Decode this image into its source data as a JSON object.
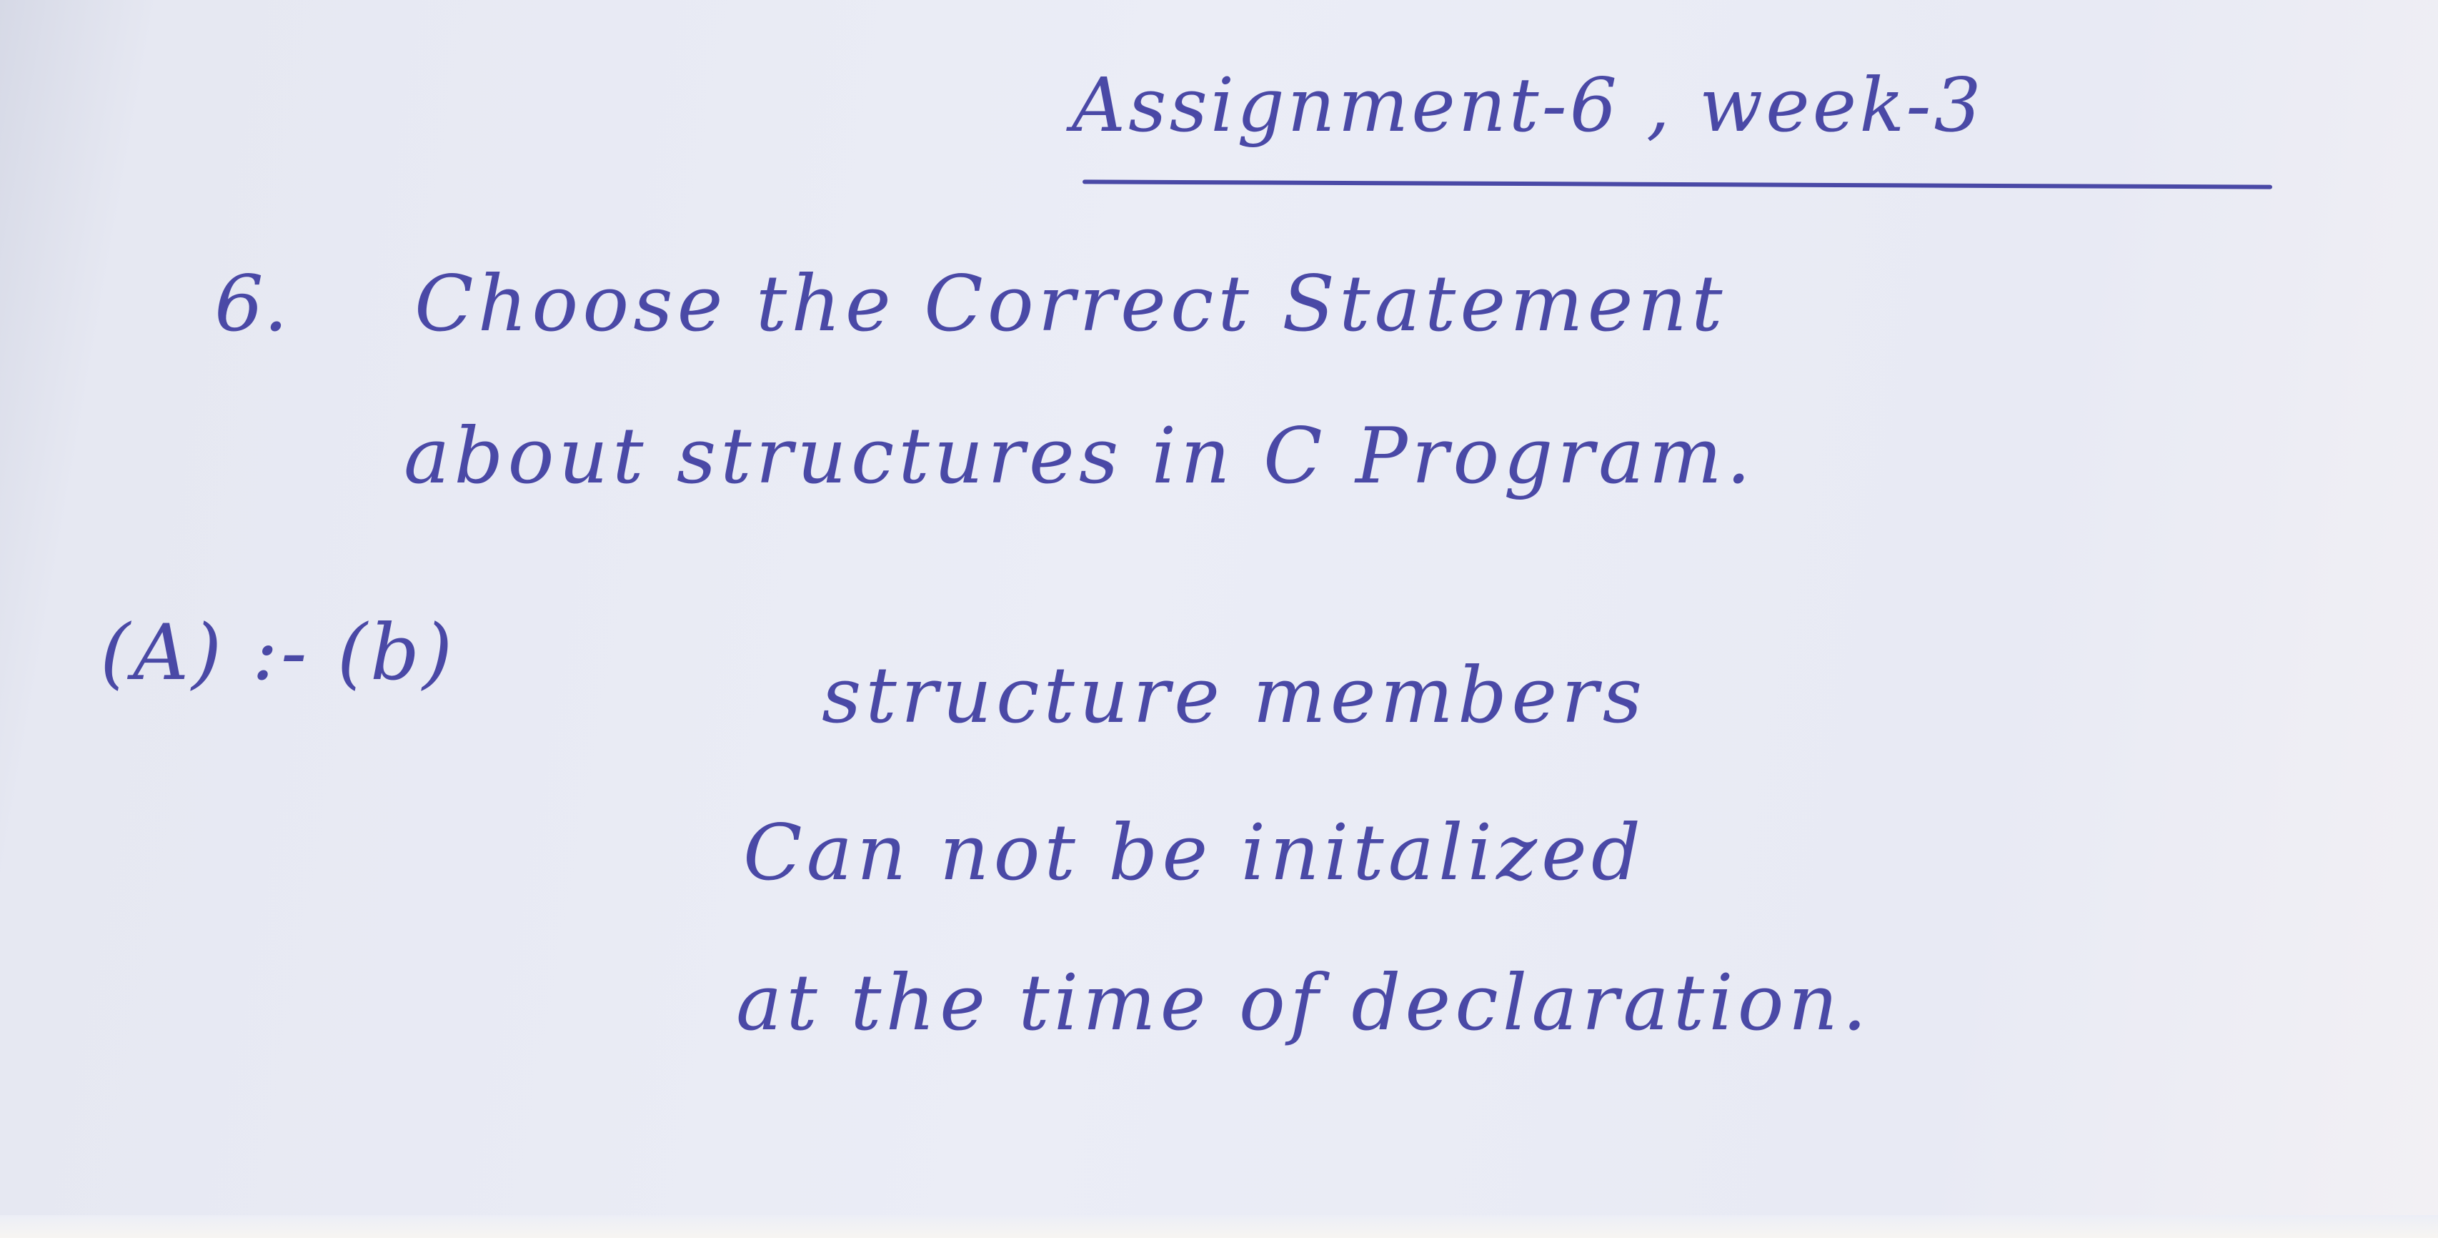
{
  "assignment": {
    "title": "Assignment-6 , week-3"
  },
  "question": {
    "number": "6.",
    "lines": [
      "Choose the Correct Statement",
      "about structures in C Program."
    ]
  },
  "answer": {
    "label": "(A) :- (b)",
    "lines": [
      "structure members",
      "Can not be initalized",
      "at the time of declaration."
    ]
  },
  "colors": {
    "ink": "#4a49a6",
    "paper": "#e8eaf4"
  }
}
